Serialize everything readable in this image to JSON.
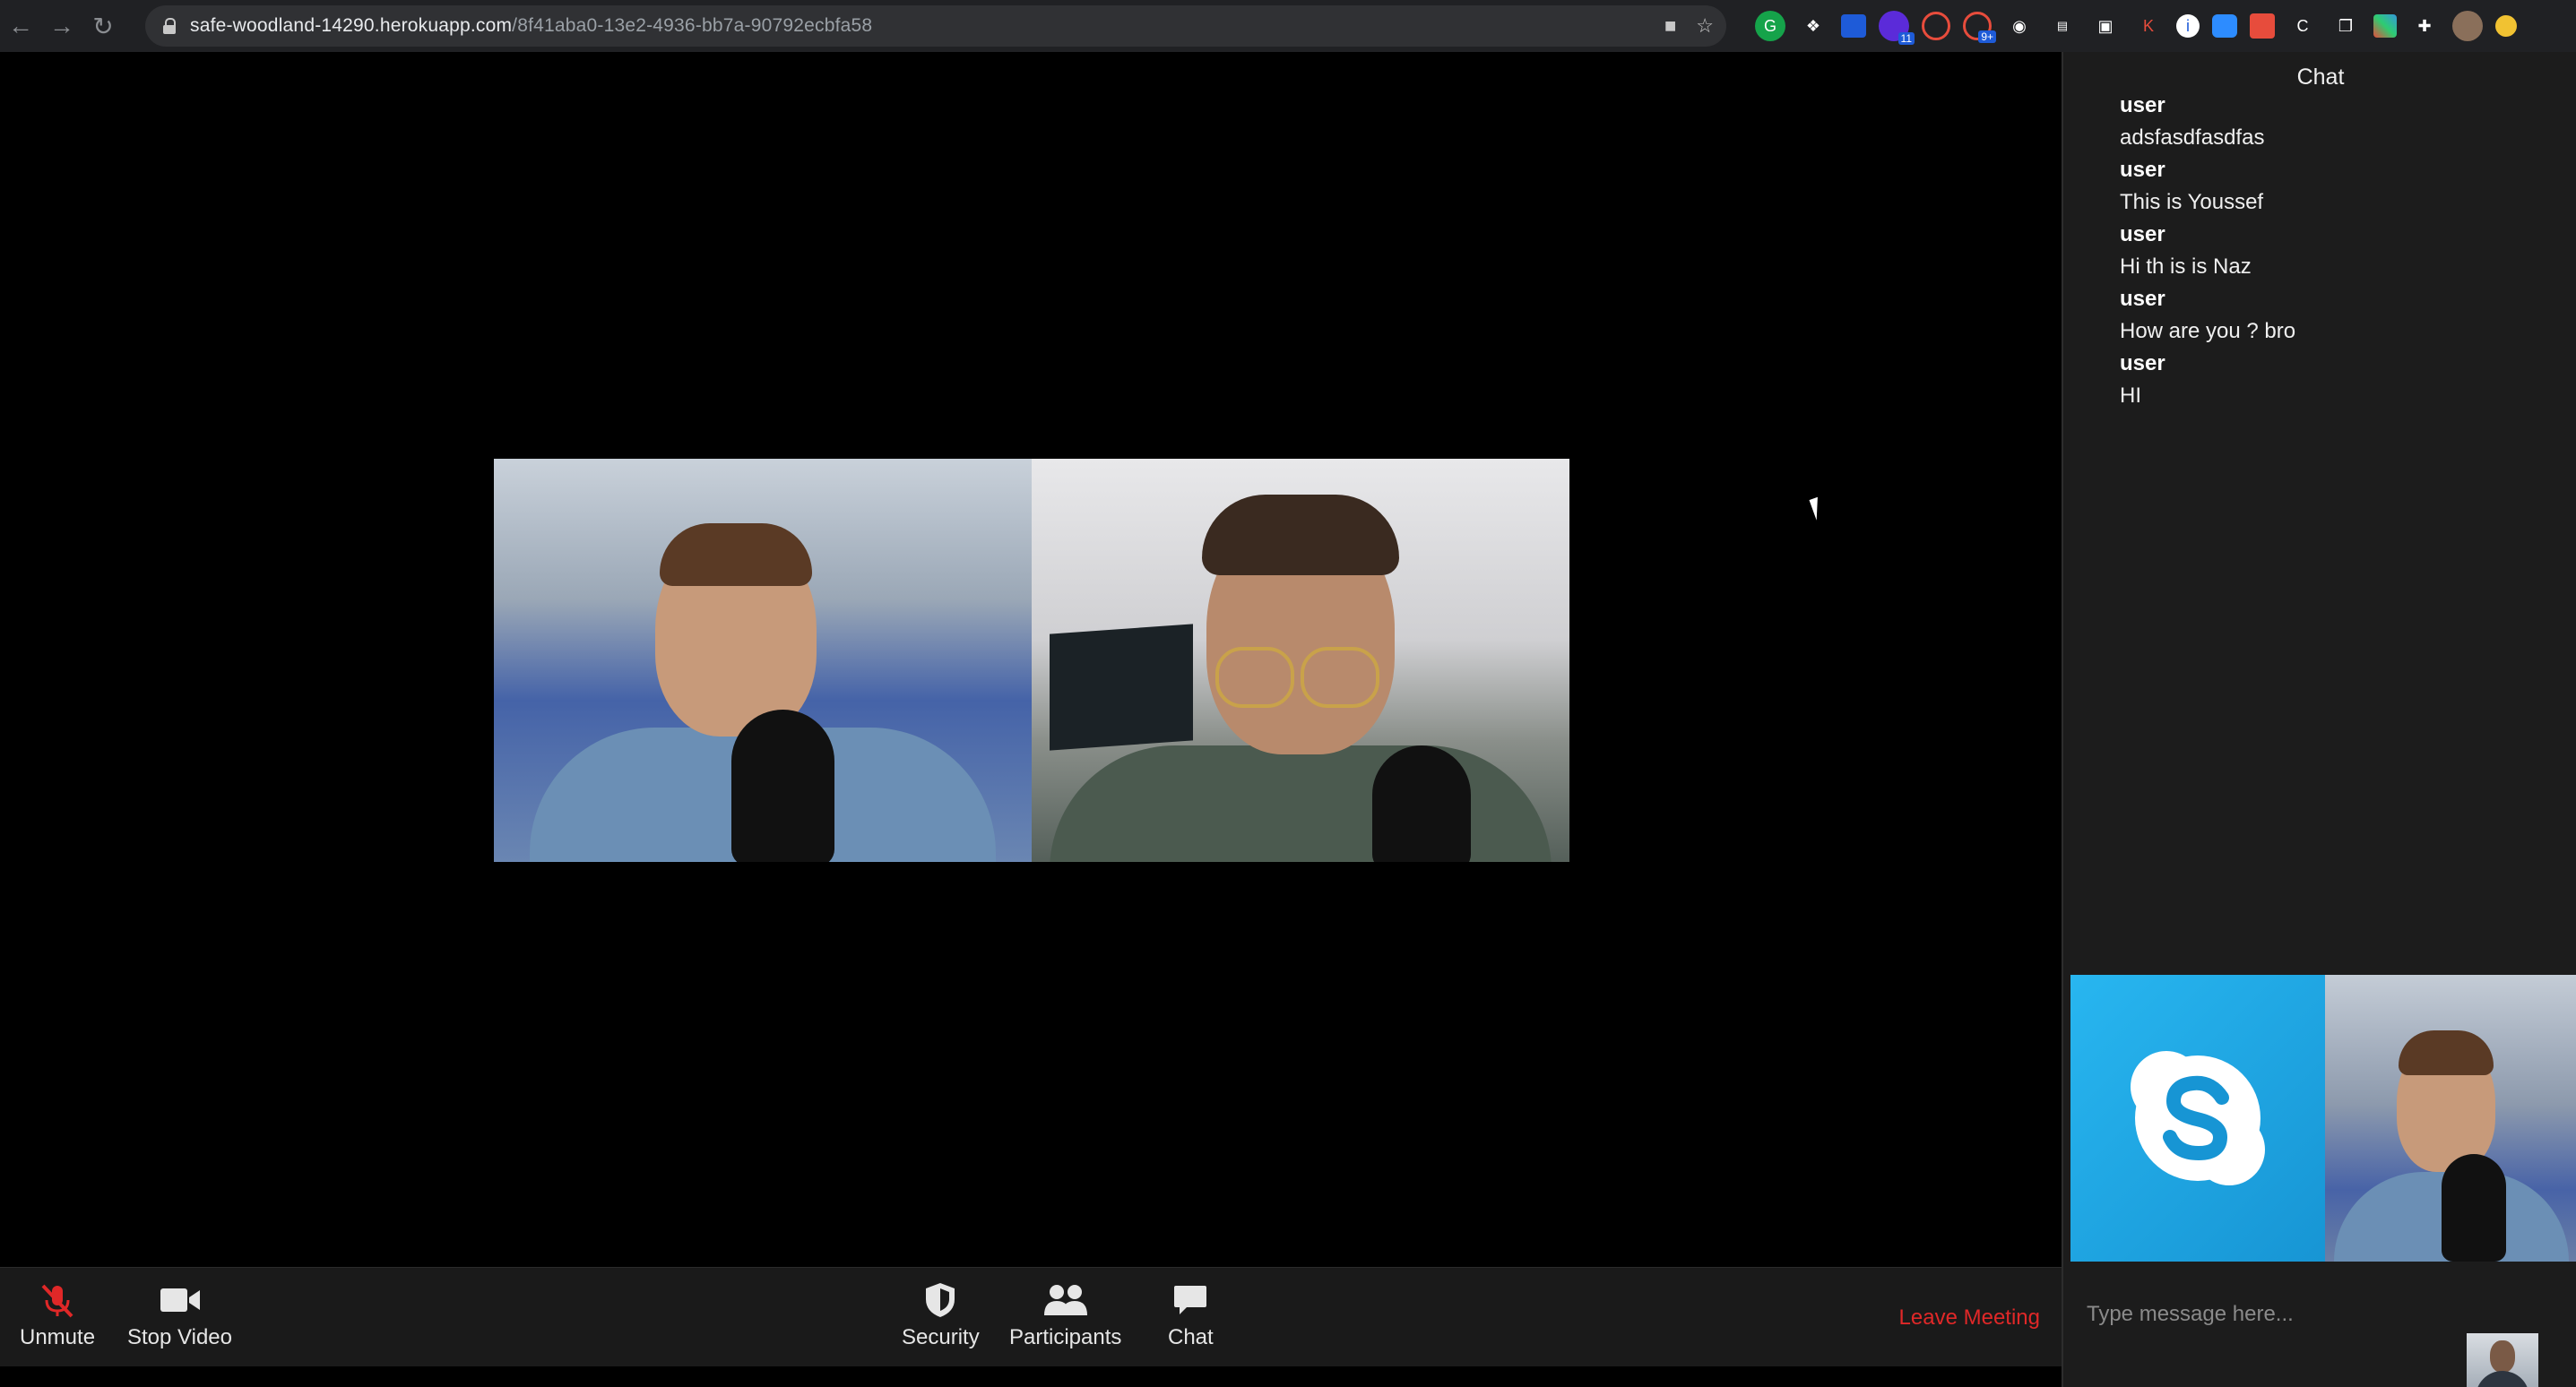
{
  "browser": {
    "url_host": "safe-woodland-14290.herokuapp.com",
    "url_path": "/8f41aba0-13e2-4936-bb7a-90792ecbfa58",
    "badges": [
      "11",
      "9+"
    ]
  },
  "toolbar": {
    "unmute_label": "Unmute",
    "stop_video_label": "Stop Video",
    "security_label": "Security",
    "participants_label": "Participants",
    "chat_label": "Chat",
    "leave_label": "Leave Meeting"
  },
  "chat": {
    "title": "Chat",
    "messages": [
      {
        "user": "user",
        "text": "adsfasdfasdfas"
      },
      {
        "user": "user",
        "text": "This is Youssef"
      },
      {
        "user": "user",
        "text": "Hi th is is Naz"
      },
      {
        "user": "user",
        "text": "How are you ? bro"
      },
      {
        "user": "user",
        "text": "HI"
      }
    ],
    "input_placeholder": "Type message here..."
  },
  "colors": {
    "leave": "#e02828",
    "muted_icon": "#e02828",
    "skype": "#1795d4"
  }
}
